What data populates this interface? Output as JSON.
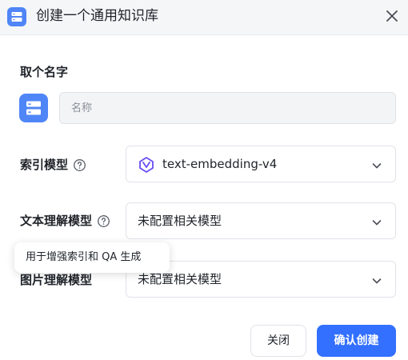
{
  "dialog": {
    "title": "创建一个通用知识库"
  },
  "name_section": {
    "label": "取个名字",
    "input_placeholder": "名称",
    "input_value": ""
  },
  "index_model": {
    "label": "索引模型",
    "selected": "text-embedding-v4",
    "logo_icon": "model-logo-icon"
  },
  "text_model": {
    "label": "文本理解模型",
    "selected": "未配置相关模型"
  },
  "tooltip": {
    "text": "用于增强索引和 QA 生成"
  },
  "image_model": {
    "label": "图片理解模型",
    "selected": "未配置相关模型"
  },
  "footer": {
    "cancel_label": "关闭",
    "confirm_label": "确认创建"
  },
  "colors": {
    "primary": "#3370ff",
    "icon_blue": "#4f86f7",
    "logo_purple": "#6a4cf5"
  }
}
